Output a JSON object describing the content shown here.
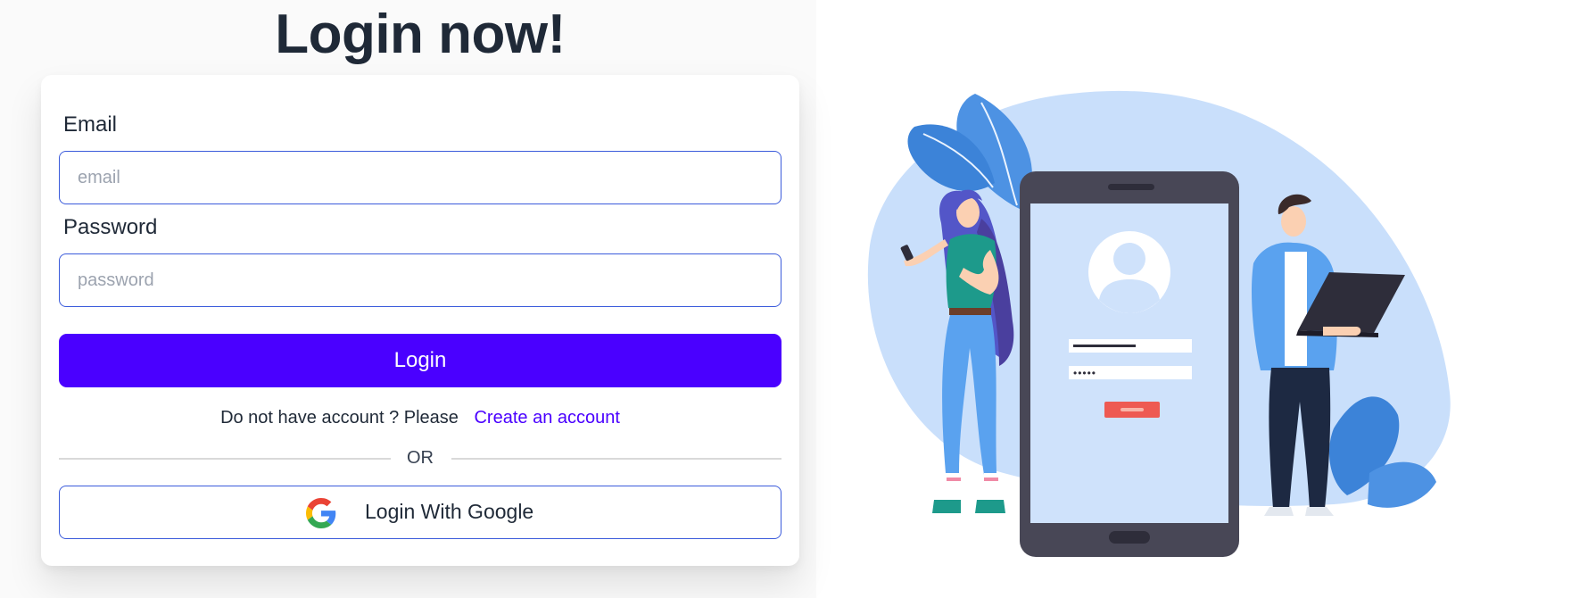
{
  "page": {
    "title": "Login now!"
  },
  "form": {
    "email_label": "Email",
    "email_placeholder": "email",
    "email_value": "",
    "password_label": "Password",
    "password_placeholder": "password",
    "password_value": "",
    "login_label": "Login",
    "signup_prompt": "Do not have account ? Please",
    "signup_link": "Create an account",
    "divider": "OR",
    "google_label": "Login With Google"
  },
  "illustration": {
    "masked_password": "•••••"
  },
  "colors": {
    "primary": "#4a00ff",
    "input_border": "#3b5bdb",
    "text": "#1f2937",
    "illustration_blob": "#c9dffb",
    "phone_frame": "#484756"
  },
  "icons": {
    "google": "google-logo-icon",
    "avatar": "user-avatar-icon"
  }
}
